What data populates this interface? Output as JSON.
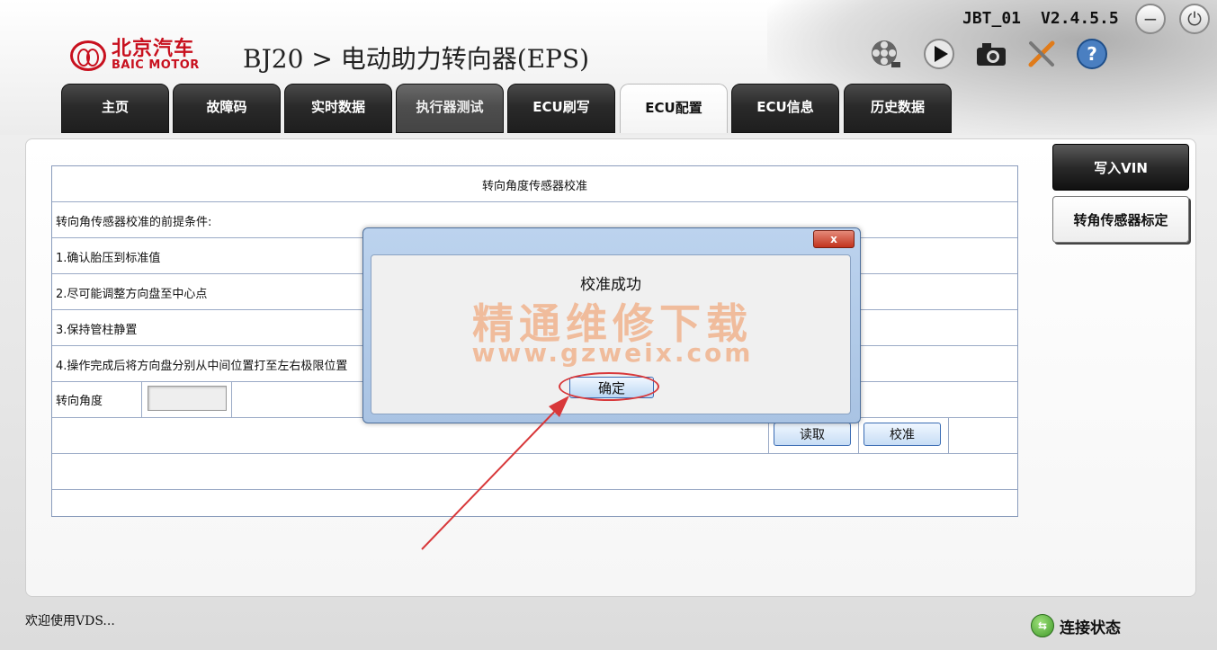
{
  "header": {
    "brand_cn": "北京汽车",
    "brand_en": "BAIC MOTOR",
    "title": "BJ20 > 电动助力转向器(EPS)",
    "device_id": "JBT_01",
    "version": "V2.4.5.5",
    "minimize_symbol": "−",
    "power_symbol": "⏻"
  },
  "toolbar": {
    "icons": [
      "film-reel-icon",
      "play-icon",
      "camera-icon",
      "tools-icon",
      "help-icon"
    ],
    "help_label": "?"
  },
  "tabs": [
    {
      "label": "主页",
      "state": "normal"
    },
    {
      "label": "故障码",
      "state": "normal"
    },
    {
      "label": "实时数据",
      "state": "normal"
    },
    {
      "label": "执行器测试",
      "state": "disabled"
    },
    {
      "label": "ECU刷写",
      "state": "normal"
    },
    {
      "label": "ECU配置",
      "state": "active"
    },
    {
      "label": "ECU信息",
      "state": "normal"
    },
    {
      "label": "历史数据",
      "state": "normal"
    }
  ],
  "table": {
    "title": "转向角度传感器校准",
    "precondition_header": "转向角传感器校准的前提条件:",
    "steps": [
      "1.确认胎压到标准值",
      "2.尽可能调整方向盘至中心点",
      "3.保持管柱静置",
      "4.操作完成后将方向盘分别从中间位置打至左右极限位置"
    ],
    "angle_label": "转向角度",
    "angle_value": "",
    "read_button": "读取",
    "calibrate_button": "校准"
  },
  "side_buttons": {
    "write_vin": "写入VIN",
    "angle_sensor_calibration": "转角传感器标定"
  },
  "dialog": {
    "close_symbol": "x",
    "message": "校准成功",
    "ok_button": "确定",
    "watermark_cn": "精通维修下载",
    "watermark_url": "www.gzweix.com"
  },
  "status_bar": {
    "welcome": "欢迎使用VDS...",
    "connection": "连接状态"
  },
  "colors": {
    "brand_red": "#c8101e",
    "dialog_border": "#4d6f9c",
    "annotation_red": "#d8383a",
    "connection_green": "#3f9a2a"
  }
}
